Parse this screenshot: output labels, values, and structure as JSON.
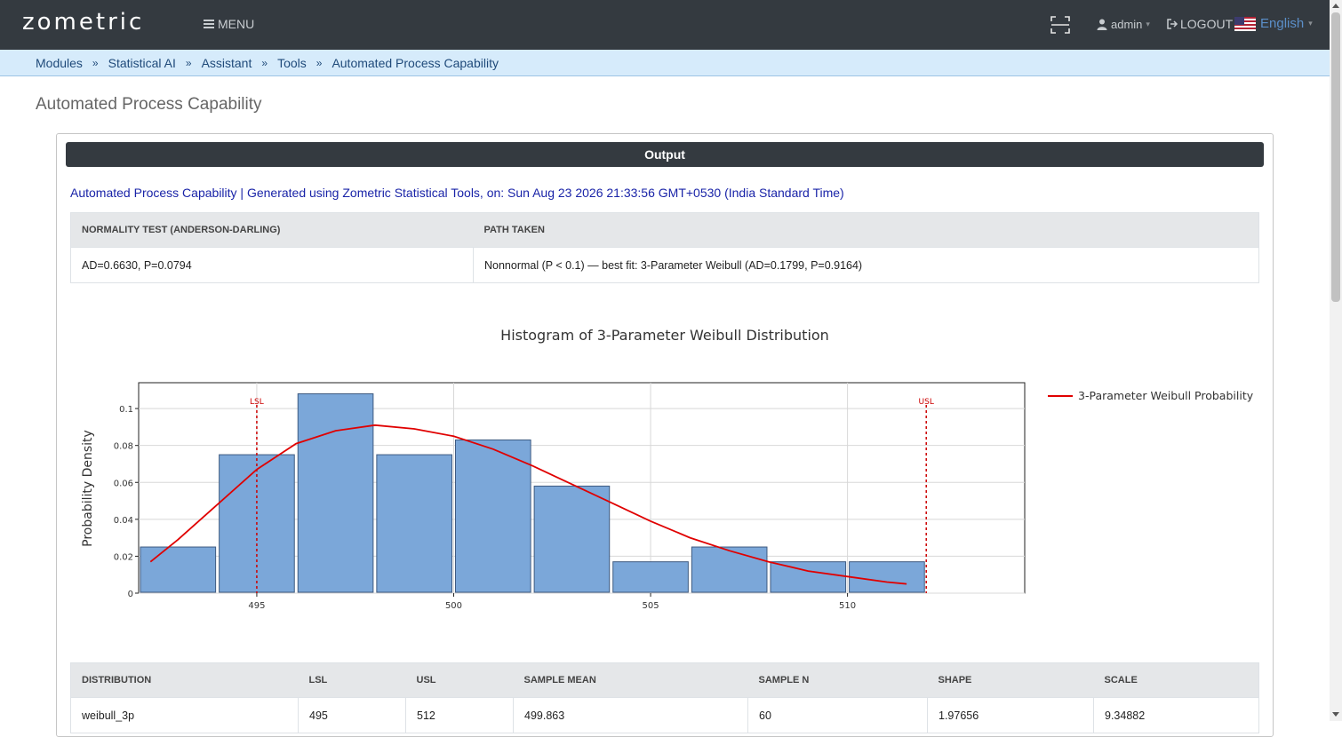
{
  "app": {
    "logo": "zometric",
    "menu_label": "MENU",
    "user": "admin",
    "logout_label": "LOGOUT",
    "language": "English"
  },
  "breadcrumb": [
    "Modules",
    "Statistical AI",
    "Assistant",
    "Tools",
    "Automated Process Capability"
  ],
  "breadcrumb_sep": "»",
  "page_title": "Automated Process Capability",
  "output_header": "Output",
  "generated_line": "Automated Process Capability | Generated using Zometric Statistical Tools, on: Sun Aug 23 2026 21:33:56 GMT+0530 (India Standard Time)",
  "normality_table": {
    "headers": [
      "NORMALITY TEST (ANDERSON-DARLING)",
      "PATH TAKEN"
    ],
    "row": [
      "AD=0.6630, P=0.0794",
      "Nonnormal (P < 0.1) — best fit: 3-Parameter Weibull (AD=0.1799, P=0.9164)"
    ]
  },
  "chart_data": {
    "type": "bar",
    "title": "Histogram of 3-Parameter Weibull Distribution",
    "ylabel": "Probability Density",
    "xlabel": "",
    "xlim": [
      492,
      514.5
    ],
    "ylim": [
      0,
      0.114
    ],
    "xticks": [
      495,
      500,
      505,
      510
    ],
    "yticks": [
      0,
      0.02,
      0.04,
      0.06,
      0.08,
      0.1
    ],
    "ytick_labels": [
      "0",
      "0.02",
      "0.04",
      "0.06",
      "0.08",
      "0.1"
    ],
    "bins": [
      {
        "x0": 492,
        "x1": 494,
        "value": 0.025
      },
      {
        "x0": 494,
        "x1": 496,
        "value": 0.075
      },
      {
        "x0": 496,
        "x1": 498,
        "value": 0.108
      },
      {
        "x0": 498,
        "x1": 500,
        "value": 0.075
      },
      {
        "x0": 500,
        "x1": 502,
        "value": 0.083
      },
      {
        "x0": 502,
        "x1": 504,
        "value": 0.058
      },
      {
        "x0": 504,
        "x1": 506,
        "value": 0.017
      },
      {
        "x0": 506,
        "x1": 508,
        "value": 0.025
      },
      {
        "x0": 508,
        "x1": 510,
        "value": 0.017
      },
      {
        "x0": 510,
        "x1": 512,
        "value": 0.017
      }
    ],
    "series": [
      {
        "name": "3-Parameter Weibull Probability",
        "color": "#e00000",
        "x": [
          492.3,
          493,
          494,
          495,
          496,
          497,
          498,
          499,
          500,
          501,
          502,
          503,
          504,
          505,
          506,
          507,
          508,
          509,
          510,
          511,
          511.5
        ],
        "y": [
          0.017,
          0.029,
          0.048,
          0.067,
          0.081,
          0.088,
          0.091,
          0.089,
          0.085,
          0.078,
          0.069,
          0.059,
          0.049,
          0.039,
          0.03,
          0.023,
          0.017,
          0.012,
          0.009,
          0.006,
          0.005
        ]
      }
    ],
    "spec_limits": [
      {
        "label": "LSL",
        "value": 495
      },
      {
        "label": "USL",
        "value": 512
      }
    ],
    "bar_color": "#7ba7d9",
    "bar_edge": "#3e5a80",
    "legend_position": "right",
    "grid": true
  },
  "summary_table": {
    "headers": [
      "DISTRIBUTION",
      "LSL",
      "USL",
      "SAMPLE MEAN",
      "SAMPLE N",
      "SHAPE",
      "SCALE"
    ],
    "row": [
      "weibull_3p",
      "495",
      "512",
      "499.863",
      "60",
      "1.97656",
      "9.34882"
    ]
  }
}
